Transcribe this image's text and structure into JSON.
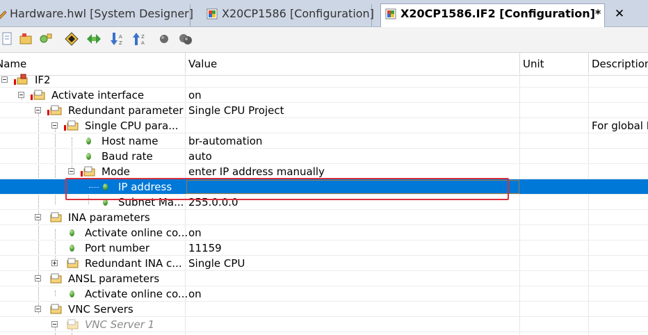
{
  "tabs": [
    {
      "label": "Hardware.hwl [System Designer]",
      "active": false
    },
    {
      "label": "X20CP1586 [Configuration]",
      "active": false
    },
    {
      "label": "X20CP1586.IF2 [Configuration]*",
      "active": true
    }
  ],
  "tab_close": "✕",
  "columns": {
    "name": "Name",
    "value": "Value",
    "unit": "Unit",
    "description": "Description"
  },
  "rows": [
    {
      "name": "IF2",
      "value": "",
      "desc": ""
    },
    {
      "name": "Activate interface",
      "value": "on",
      "desc": ""
    },
    {
      "name": "Redundant parameter",
      "value": "Single CPU Project",
      "desc": ""
    },
    {
      "name": "Single CPU para...",
      "value": "",
      "desc": "For global E"
    },
    {
      "name": "Host name",
      "value": "br-automation",
      "desc": ""
    },
    {
      "name": "Baud rate",
      "value": "auto",
      "desc": ""
    },
    {
      "name": "Mode",
      "value": "enter IP address manually",
      "desc": ""
    },
    {
      "name": "IP address",
      "value": "",
      "desc": ""
    },
    {
      "name": "Subnet Ma...",
      "value": "255.0.0.0",
      "desc": ""
    },
    {
      "name": "INA parameters",
      "value": "",
      "desc": ""
    },
    {
      "name": "Activate online co...",
      "value": "on",
      "desc": ""
    },
    {
      "name": "Port number",
      "value": "11159",
      "desc": ""
    },
    {
      "name": "Redundant INA c...",
      "value": "Single CPU",
      "desc": ""
    },
    {
      "name": "ANSL parameters",
      "value": "",
      "desc": ""
    },
    {
      "name": "Activate online co...",
      "value": "on",
      "desc": ""
    },
    {
      "name": "VNC Servers",
      "value": "",
      "desc": ""
    },
    {
      "name": "VNC Server 1",
      "value": "",
      "desc": ""
    }
  ],
  "colors": {
    "selection": "#0078d7",
    "highlight_box": "#d9303a",
    "tab_strip": "#cdd6e4"
  }
}
